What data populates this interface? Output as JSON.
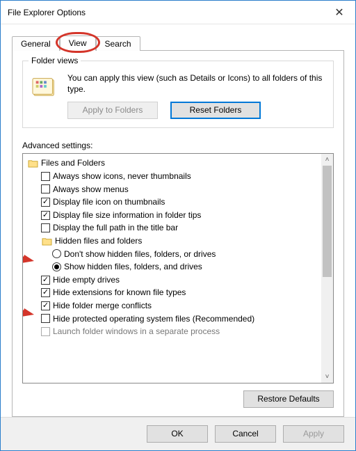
{
  "window": {
    "title": "File Explorer Options"
  },
  "tabs": {
    "general": "General",
    "view": "View",
    "search": "Search"
  },
  "folderViews": {
    "legend": "Folder views",
    "text": "You can apply this view (such as Details or Icons) to all folders of this type.",
    "applyBtn": "Apply to Folders",
    "resetBtn": "Reset Folders"
  },
  "advanced": {
    "label": "Advanced settings:",
    "root": "Files and Folders",
    "items": [
      {
        "kind": "check",
        "checked": false,
        "label": "Always show icons, never thumbnails"
      },
      {
        "kind": "check",
        "checked": false,
        "label": "Always show menus"
      },
      {
        "kind": "check",
        "checked": true,
        "label": "Display file icon on thumbnails"
      },
      {
        "kind": "check",
        "checked": true,
        "label": "Display file size information in folder tips"
      },
      {
        "kind": "check",
        "checked": false,
        "label": "Display the full path in the title bar"
      },
      {
        "kind": "folder",
        "label": "Hidden files and folders"
      },
      {
        "kind": "radio",
        "checked": false,
        "label": "Don't show hidden files, folders, or drives"
      },
      {
        "kind": "radio",
        "checked": true,
        "label": "Show hidden files, folders, and drives"
      },
      {
        "kind": "check",
        "checked": true,
        "label": "Hide empty drives"
      },
      {
        "kind": "check",
        "checked": true,
        "label": "Hide extensions for known file types"
      },
      {
        "kind": "check",
        "checked": true,
        "label": "Hide folder merge conflicts"
      },
      {
        "kind": "check",
        "checked": false,
        "label": "Hide protected operating system files (Recommended)"
      },
      {
        "kind": "check",
        "checked": false,
        "label_cut": "Launch folder windows in a separate process"
      }
    ],
    "restoreBtn": "Restore Defaults"
  },
  "footer": {
    "ok": "OK",
    "cancel": "Cancel",
    "apply": "Apply"
  },
  "annotations": {
    "circled_tab": "View",
    "arrows": [
      "radio-show-hidden",
      "check-hide-protected-os-files"
    ]
  }
}
